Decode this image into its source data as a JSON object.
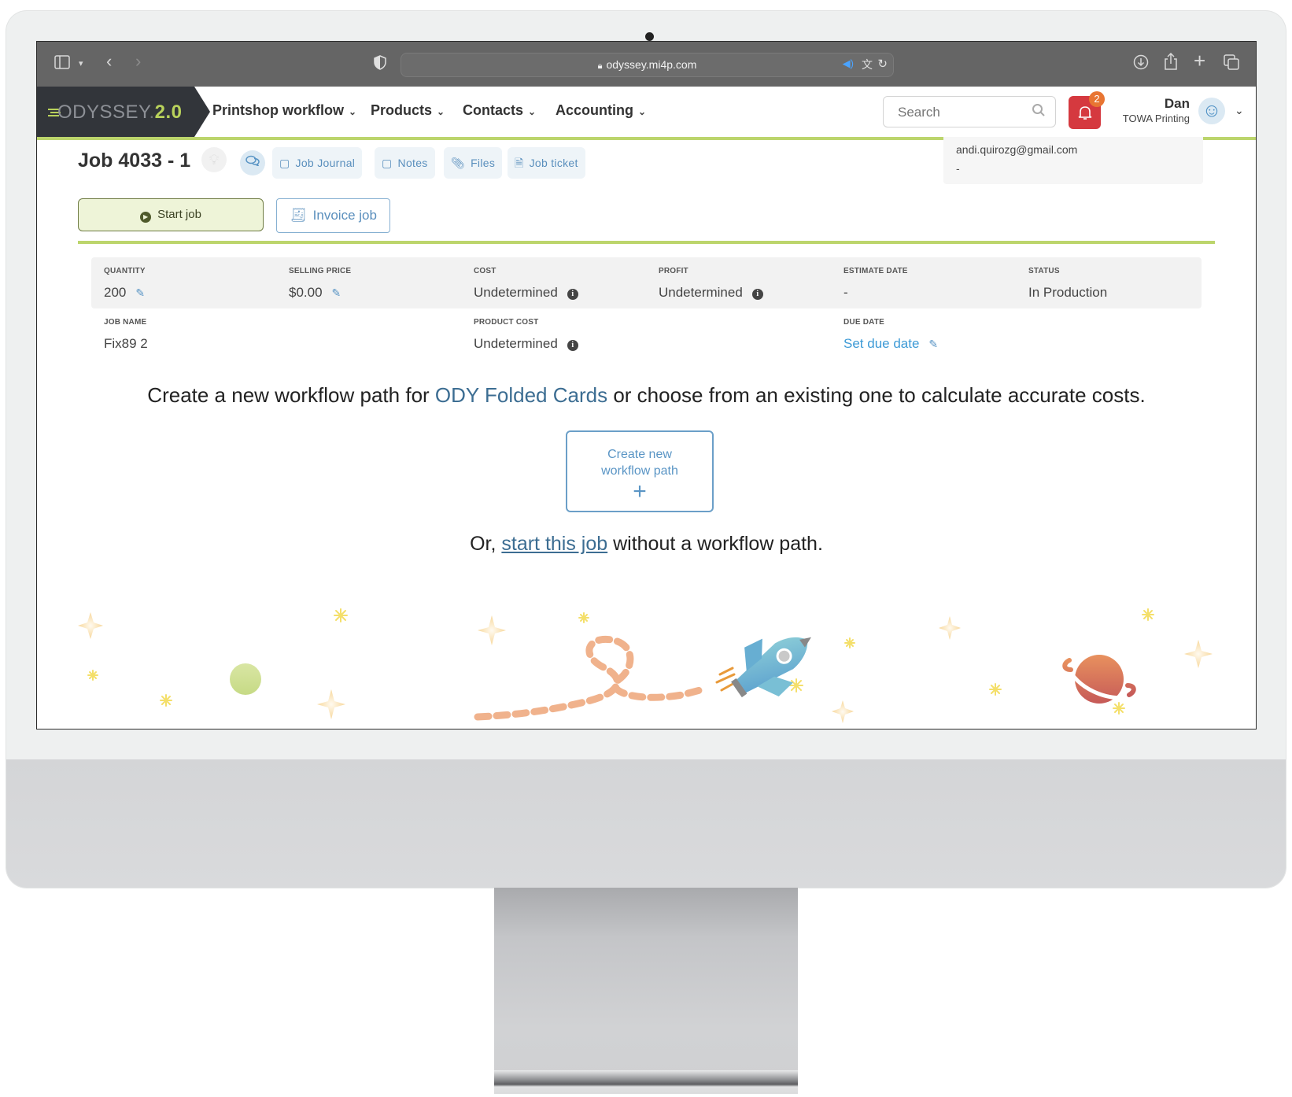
{
  "browser": {
    "url": "odyssey.mi4p.com",
    "icons": [
      "sidebar-icon",
      "chevron-down-icon",
      "back-icon",
      "forward-icon",
      "shield-icon",
      "lock-icon",
      "speaker-icon",
      "translate-icon",
      "reload-icon",
      "download-icon",
      "share-icon",
      "new-tab-icon",
      "tabs-icon"
    ]
  },
  "app": {
    "logo": {
      "name": "ODYSSEY",
      "version": "2.0"
    },
    "nav": [
      {
        "label": "Printshop workflow"
      },
      {
        "label": "Products"
      },
      {
        "label": "Contacts"
      },
      {
        "label": "Accounting"
      }
    ],
    "search": {
      "placeholder": "Search"
    },
    "notifications": {
      "count": "2"
    },
    "user": {
      "name": "Dan",
      "company": "TOWA Printing"
    }
  },
  "job": {
    "title": "Job 4033 - 1",
    "tabs": [
      {
        "label": "Job Journal",
        "icon": "journal-icon"
      },
      {
        "label": "Notes",
        "icon": "notes-icon"
      },
      {
        "label": "Files",
        "icon": "paperclip-icon"
      },
      {
        "label": "Job ticket",
        "icon": "document-icon"
      }
    ],
    "start_label": "Start job",
    "invoice_label": "Invoice job",
    "contact": {
      "email": "andi.quirozg@gmail.com",
      "phone": "-"
    },
    "fields": {
      "quantity": {
        "label": "QUANTITY",
        "value": "200"
      },
      "selling_price": {
        "label": "SELLING PRICE",
        "value": "$0.00"
      },
      "cost": {
        "label": "COST",
        "value": "Undetermined"
      },
      "profit": {
        "label": "PROFIT",
        "value": "Undetermined"
      },
      "estimate_date": {
        "label": "ESTIMATE DATE",
        "value": "-"
      },
      "status": {
        "label": "STATUS",
        "value": "In Production"
      },
      "job_name": {
        "label": "JOB NAME",
        "value": "Fix89 2"
      },
      "product_cost": {
        "label": "PRODUCT COST",
        "value": "Undetermined"
      },
      "due_date": {
        "label": "DUE DATE",
        "value": "Set due date"
      }
    }
  },
  "workflow": {
    "headline_before": "Create a new workflow path for ",
    "product": "ODY Folded Cards",
    "headline_after": " or choose from an existing one to calculate accurate costs.",
    "create_line1": "Create new",
    "create_line2": "workflow path",
    "create_plus": "+",
    "or_before": "Or, ",
    "or_link": "start this job",
    "or_after": " without a workflow path."
  },
  "colors": {
    "accent_green": "#bcd56c",
    "link_blue": "#3d9ad6",
    "product_blue": "#3c6d92",
    "bell_red": "#d5393f",
    "badge_orange": "#e87532",
    "logo_bg": "#32353a"
  }
}
